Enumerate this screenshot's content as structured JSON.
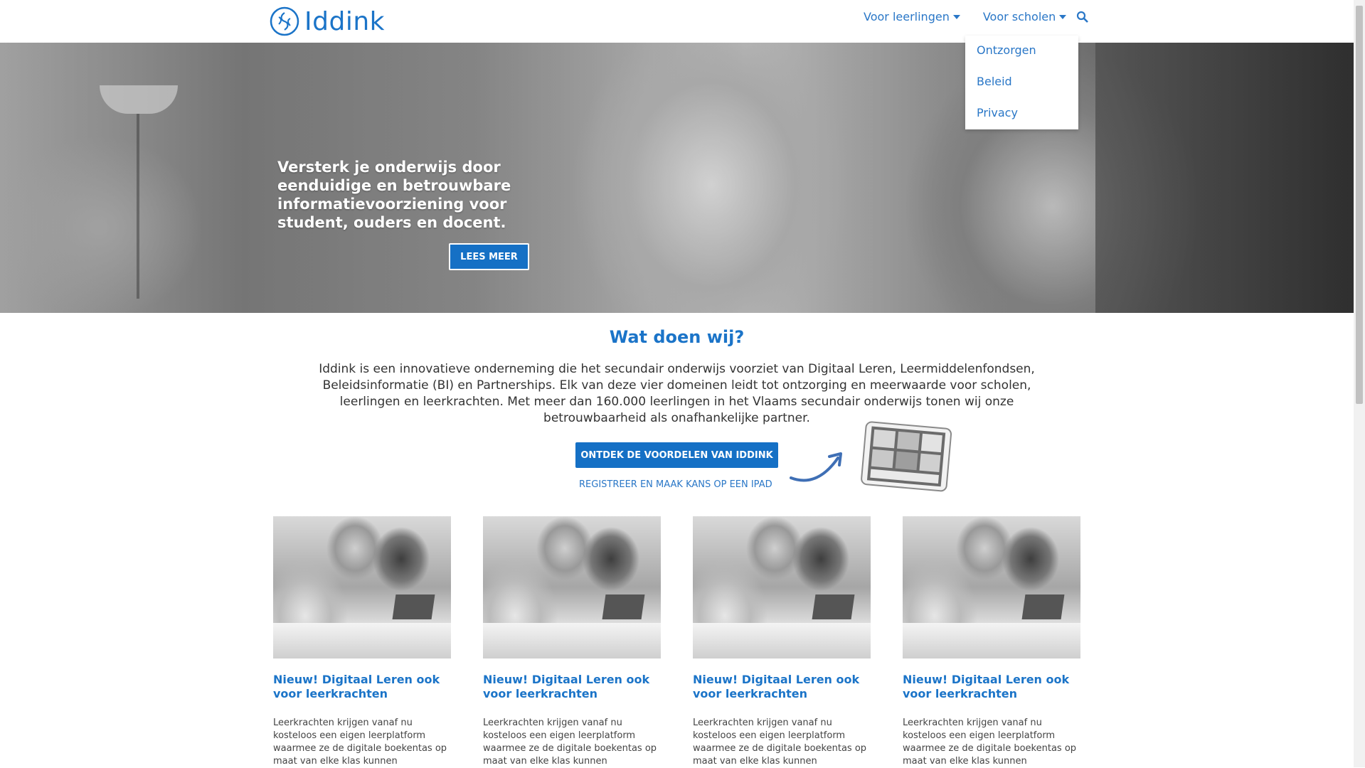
{
  "header": {
    "logo_text": "Iddink",
    "nav": [
      {
        "label": "Voor leerlingen"
      },
      {
        "label": "Voor scholen"
      }
    ],
    "dropdown": [
      "Ontzorgen",
      "Beleid",
      "Privacy"
    ]
  },
  "hero": {
    "text": "Versterk je onderwijs door eenduidige en betrouwbare informatievoorziening voor student, ouders en docent.",
    "button": "LEES MEER"
  },
  "intro": {
    "title": "Wat doen wij?",
    "text": "Iddink is een innovatieve onderneming die het secundair onderwijs voorziet van Digitaal Leren, Leermiddelenfondsen, Beleidsinformatie (BI) en Partnerships. Elk van deze vier domeinen leidt tot ontzorging en meerwaarde voor scholen, leerlingen en leerkrachten. Met meer dan 160.000 leerlingen in het Vlaams secundair onderwijs tonen wij onze betrouwbaarheid als onafhankelijke partner.",
    "cta": "ONTDEK DE VOORDELEN VAN IDDINK",
    "register": "REGISTREER EN MAAK KANS OP EEN IPAD"
  },
  "cards": [
    {
      "title": "Nieuw! Digitaal Leren ook voor leerkrachten",
      "desc": "Leerkrachten krijgen vanaf nu kosteloos een eigen leerplatform waarmee ze de digitale boekentas op maat van elke klas kunnen"
    },
    {
      "title": "Nieuw! Digitaal Leren ook voor leerkrachten",
      "desc": "Leerkrachten krijgen vanaf nu kosteloos een eigen leerplatform waarmee ze de digitale boekentas op maat van elke klas kunnen"
    },
    {
      "title": "Nieuw! Digitaal Leren ook voor leerkrachten",
      "desc": "Leerkrachten krijgen vanaf nu kosteloos een eigen leerplatform waarmee ze de digitale boekentas op maat van elke klas kunnen"
    },
    {
      "title": "Nieuw! Digitaal Leren ook voor leerkrachten",
      "desc": "Leerkrachten krijgen vanaf nu kosteloos een eigen leerplatform waarmee ze de digitale boekentas op maat van elke klas kunnen"
    }
  ],
  "colors": {
    "brand": "#1b74c8",
    "button": "#1570c5"
  },
  "icons": {
    "logo": "iddink-logo-icon",
    "search": "search-icon",
    "dropdown": "caret-down-icon"
  }
}
